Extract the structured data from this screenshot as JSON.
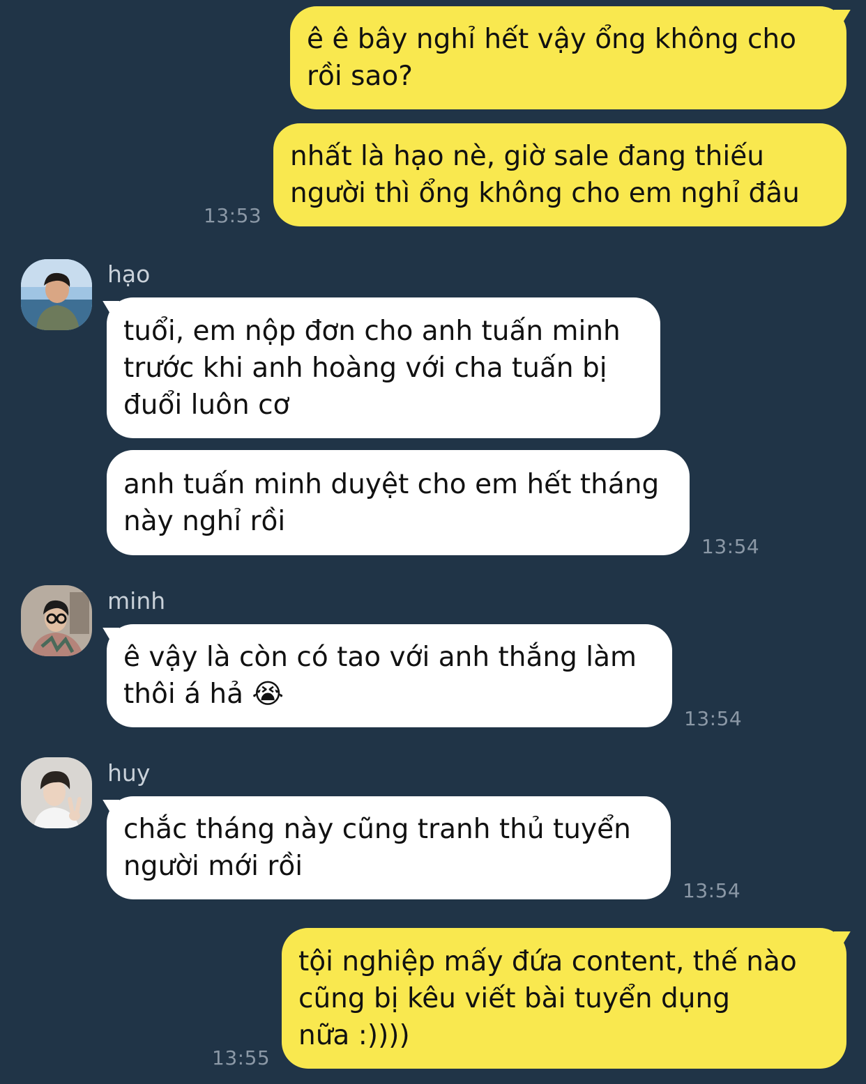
{
  "messages": {
    "m1": {
      "lines": [
        "ê ê bây nghỉ hết vậy ổng không cho",
        "rồi sao?"
      ]
    },
    "m2": {
      "lines": [
        "nhất là hạo nè, giờ sale đang thiếu",
        "người thì ổng không cho em nghỉ đâu"
      ],
      "time": "13:53"
    },
    "m3": {
      "sender": "hạo",
      "lines": [
        "tuổi, em nộp đơn cho anh tuấn minh",
        "trước khi anh hoàng với cha tuấn bị",
        "đuổi luôn cơ"
      ]
    },
    "m4": {
      "lines": [
        "anh tuấn minh duyệt cho em hết tháng",
        "này nghỉ rồi"
      ],
      "time": "13:54"
    },
    "m5": {
      "sender": "minh",
      "lines": [
        "ê vậy là còn có tao với anh thắng làm",
        "thôi á hả 😭"
      ],
      "time": "13:54"
    },
    "m6": {
      "sender": "huy",
      "lines": [
        "chắc tháng này cũng tranh thủ tuyển",
        "người mới rồi"
      ],
      "time": "13:54"
    },
    "m7": {
      "lines": [
        "tội nghiệp mấy đứa content, thế nào",
        "cũng bị kêu viết bài tuyển dụng",
        "nữa :))))"
      ],
      "time": "13:55"
    }
  },
  "avatars": {
    "hao": "avatar-photo-hao",
    "minh": "avatar-photo-minh",
    "huy": "avatar-photo-huy"
  },
  "colors": {
    "background": "#203447",
    "outgoing_bubble": "#f9e84f",
    "incoming_bubble": "#ffffff",
    "timestamp": "#8b98a6",
    "sender_name": "#c9d1d9"
  }
}
